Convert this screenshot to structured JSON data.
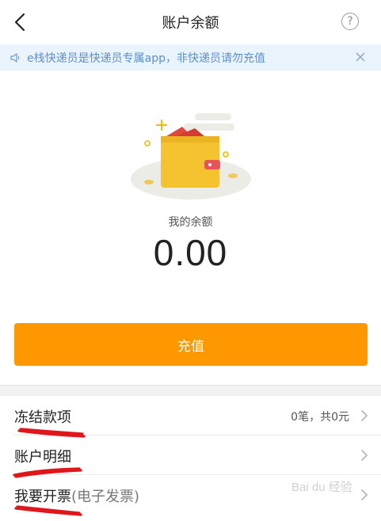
{
  "nav": {
    "title": "账户余额",
    "help_symbol": "?"
  },
  "notice": {
    "text": "e栈快递员是快递员专属app，非快递员请勿充值"
  },
  "balance": {
    "label": "我的余额",
    "value": "0.00"
  },
  "recharge": {
    "label": "充值"
  },
  "rows": [
    {
      "label": "冻结款项",
      "sub": "",
      "value": "0笔，共0元"
    },
    {
      "label": "账户明细",
      "sub": "",
      "value": ""
    },
    {
      "label": "我要开票",
      "sub": "(电子发票)",
      "value": ""
    }
  ],
  "watermark": {
    "text": "Bai du 经验"
  },
  "colors": {
    "accent": "#ff9800",
    "notice_bg": "#eaf4fd",
    "notice_text": "#5b8fd0",
    "annotation": "#e0161b"
  }
}
